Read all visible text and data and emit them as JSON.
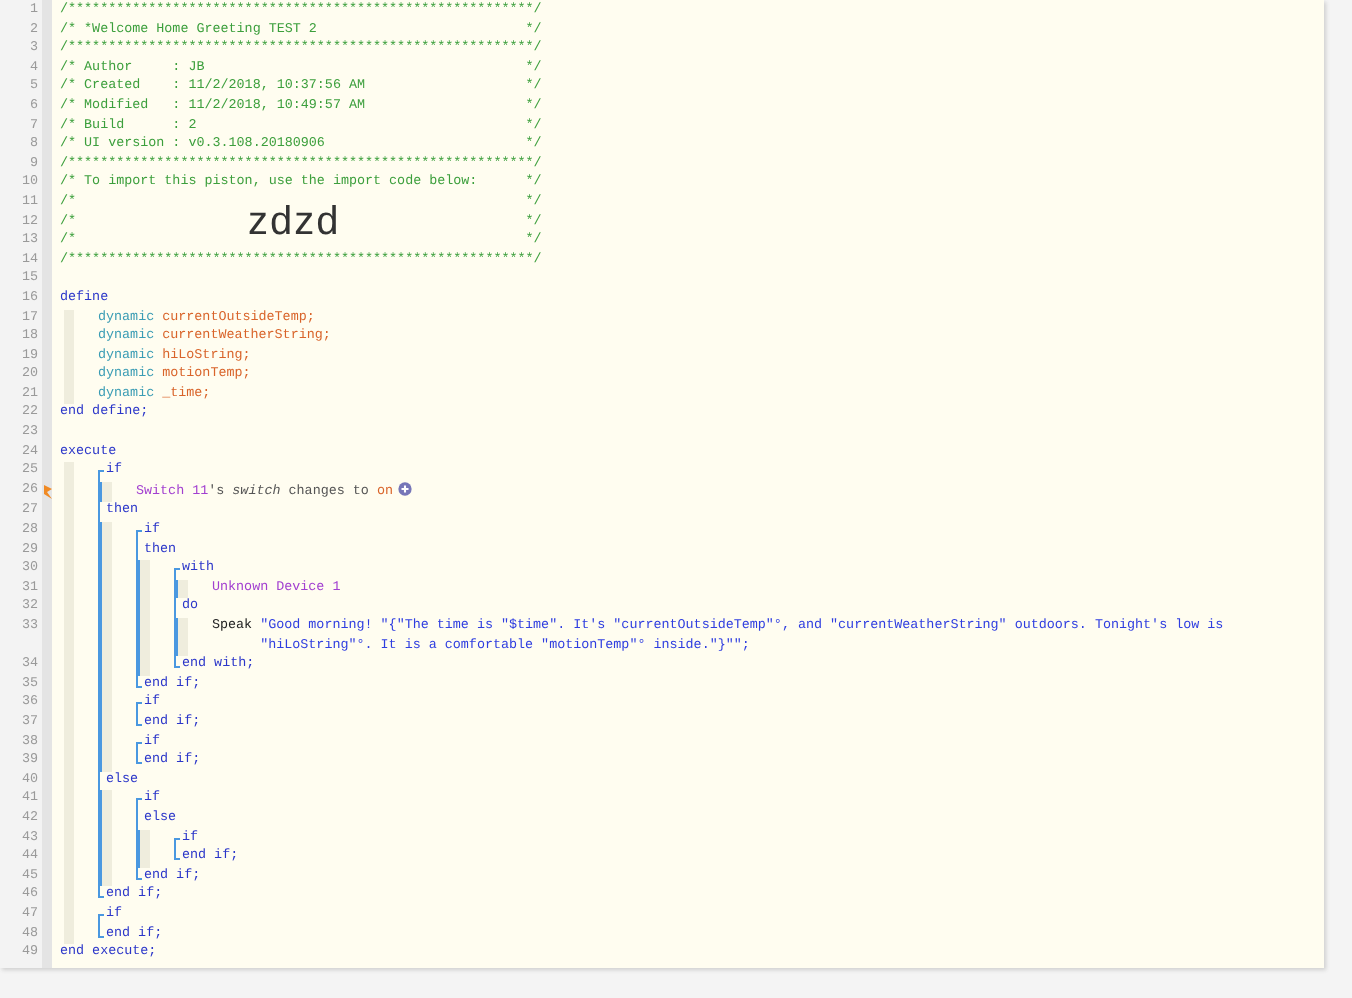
{
  "lines": [
    {
      "number": "1",
      "kind": "code",
      "flagged": false,
      "segments": [
        {
          "text": "/**********************************************************/",
          "kind": "comment"
        }
      ]
    },
    {
      "number": "2",
      "kind": "code",
      "flagged": false,
      "segments": [
        {
          "text": "/* *Welcome Home Greeting TEST 2",
          "kind": "comment"
        },
        {
          "text": "*/",
          "kind": "comment-end"
        }
      ]
    },
    {
      "number": "3",
      "kind": "code",
      "flagged": false,
      "segments": [
        {
          "text": "/**********************************************************/",
          "kind": "comment"
        }
      ]
    },
    {
      "number": "4",
      "kind": "code",
      "flagged": false,
      "segments": [
        {
          "text": "/* Author     : JB",
          "kind": "comment"
        },
        {
          "text": "*/",
          "kind": "comment-end"
        }
      ]
    },
    {
      "number": "5",
      "kind": "code",
      "flagged": false,
      "segments": [
        {
          "text": "/* Created    : 11/2/2018, 10:37:56 AM",
          "kind": "comment"
        },
        {
          "text": "*/",
          "kind": "comment-end"
        }
      ]
    },
    {
      "number": "6",
      "kind": "code",
      "flagged": false,
      "segments": [
        {
          "text": "/* Modified   : 11/2/2018, 10:49:57 AM",
          "kind": "comment"
        },
        {
          "text": "*/",
          "kind": "comment-end"
        }
      ]
    },
    {
      "number": "7",
      "kind": "code",
      "flagged": false,
      "segments": [
        {
          "text": "/* Build      : 2",
          "kind": "comment"
        },
        {
          "text": "*/",
          "kind": "comment-end"
        }
      ]
    },
    {
      "number": "8",
      "kind": "code",
      "flagged": false,
      "segments": [
        {
          "text": "/* UI version : v0.3.108.20180906",
          "kind": "comment"
        },
        {
          "text": "*/",
          "kind": "comment-end"
        }
      ]
    },
    {
      "number": "9",
      "kind": "code",
      "flagged": false,
      "segments": [
        {
          "text": "/**********************************************************/",
          "kind": "comment"
        }
      ]
    },
    {
      "number": "10",
      "kind": "code",
      "flagged": false,
      "segments": [
        {
          "text": "/* To import this piston, use the import code below:",
          "kind": "comment"
        },
        {
          "text": "*/",
          "kind": "comment-end"
        }
      ]
    },
    {
      "number": "11",
      "kind": "code",
      "flagged": false,
      "segments": [
        {
          "text": "/*",
          "kind": "comment"
        },
        {
          "text": "*/",
          "kind": "comment-end"
        }
      ]
    },
    {
      "number": "12",
      "kind": "code",
      "flagged": false,
      "segments": [
        {
          "text": "/*",
          "kind": "comment"
        },
        {
          "text": "zdzd",
          "kind": "big"
        },
        {
          "text": "*/",
          "kind": "comment-end"
        }
      ]
    },
    {
      "number": "13",
      "kind": "code",
      "flagged": false,
      "segments": [
        {
          "text": "/*",
          "kind": "comment"
        },
        {
          "text": "*/",
          "kind": "comment-end"
        }
      ]
    },
    {
      "number": "14",
      "kind": "code",
      "flagged": false,
      "segments": [
        {
          "text": "/**********************************************************/",
          "kind": "comment"
        }
      ]
    },
    {
      "number": "15",
      "kind": "code",
      "flagged": false
    },
    {
      "number": "16",
      "kind": "code",
      "flagged": false,
      "segments": [
        {
          "text": "define",
          "kind": "keyword"
        }
      ],
      "children": [
        {
          "number": "17",
          "kind": "code",
          "flagged": false,
          "segments": [
            {
              "text": "dynamic ",
              "kind": "type"
            },
            {
              "text": "currentOutsideTemp;",
              "kind": "variable"
            }
          ]
        },
        {
          "number": "18",
          "kind": "code",
          "flagged": false,
          "segments": [
            {
              "text": "dynamic ",
              "kind": "type"
            },
            {
              "text": "currentWeatherString;",
              "kind": "variable"
            }
          ]
        },
        {
          "number": "19",
          "kind": "code",
          "flagged": false,
          "segments": [
            {
              "text": "dynamic ",
              "kind": "type"
            },
            {
              "text": "hiLoString;",
              "kind": "variable"
            }
          ]
        },
        {
          "number": "20",
          "kind": "code",
          "flagged": false,
          "segments": [
            {
              "text": "dynamic ",
              "kind": "type"
            },
            {
              "text": "motionTemp;",
              "kind": "variable"
            }
          ]
        },
        {
          "number": "21",
          "kind": "code",
          "flagged": false,
          "segments": [
            {
              "text": "dynamic ",
              "kind": "type"
            },
            {
              "text": "_time;",
              "kind": "variable"
            }
          ]
        }
      ]
    },
    {
      "number": "22",
      "kind": "code",
      "flagged": false,
      "segments": [
        {
          "text": "end define;",
          "kind": "keyword"
        }
      ]
    },
    {
      "number": "23",
      "kind": "code",
      "flagged": false
    },
    {
      "number": "24",
      "kind": "code",
      "flagged": false,
      "segments": [
        {
          "text": "execute",
          "kind": "keyword"
        }
      ],
      "children": [
        {
          "number": "25",
          "kind": "open",
          "flagged": false,
          "segments": [
            {
              "text": "if",
              "kind": "keyword"
            }
          ],
          "children": [
            {
              "number": "26",
              "kind": "code",
              "flagged": true,
              "segments": [
                {
                  "text": "Switch 11",
                  "kind": "device"
                },
                {
                  "text": "'s *switch* changes to ",
                  "kind": "phrase"
                },
                {
                  "text": "on",
                  "kind": "value"
                },
                {
                  "kind": "add-icon"
                }
              ]
            }
          ]
        },
        {
          "number": "27",
          "kind": "code",
          "flagged": false,
          "segments": [
            {
              "text": "then",
              "kind": "keyword"
            }
          ],
          "children": [
            {
              "number": "28",
              "kind": "open",
              "flagged": false,
              "segments": [
                {
                  "text": "if",
                  "kind": "keyword"
                }
              ]
            },
            {
              "number": "29",
              "kind": "code",
              "flagged": false,
              "segments": [
                {
                  "text": "then",
                  "kind": "keyword"
                }
              ],
              "children": [
                {
                  "number": "30",
                  "kind": "open",
                  "flagged": false,
                  "segments": [
                    {
                      "text": "with",
                      "kind": "keyword"
                    }
                  ],
                  "children": [
                    {
                      "number": "31",
                      "kind": "code",
                      "flagged": false,
                      "segments": [
                        {
                          "text": "Unknown Device 1",
                          "kind": "device"
                        }
                      ]
                    }
                  ]
                },
                {
                  "number": "32",
                  "kind": "code",
                  "flagged": false,
                  "segments": [
                    {
                      "text": "do",
                      "kind": "keyword"
                    }
                  ],
                  "children": [
                    {
                      "number": "33",
                      "kind": "code",
                      "flagged": false,
                      "segments": [
                        {
                          "text": "Speak ",
                          "kind": "command"
                        },
                        {
                          "text": "\"Good morning! \"{\"The time is \"$time\". It's \"currentOutsideTemp\"°, and \"currentWeatherString\" outdoors. Tonight's low is \"hiLoString\"°. It is a comfortable \"motionTemp\"° inside.\"}\"\";",
                          "kind": "string"
                        }
                      ]
                    }
                  ]
                },
                {
                  "number": "34",
                  "kind": "close",
                  "flagged": false,
                  "segments": [
                    {
                      "text": "end with;",
                      "kind": "keyword"
                    }
                  ]
                }
              ]
            },
            {
              "number": "35",
              "kind": "close",
              "flagged": false,
              "segments": [
                {
                  "text": "end if;",
                  "kind": "keyword"
                }
              ]
            },
            {
              "number": "36",
              "kind": "open",
              "flagged": false,
              "segments": [
                {
                  "text": "if",
                  "kind": "keyword"
                }
              ]
            },
            {
              "number": "37",
              "kind": "close",
              "flagged": false,
              "segments": [
                {
                  "text": "end if;",
                  "kind": "keyword"
                }
              ]
            },
            {
              "number": "38",
              "kind": "open",
              "flagged": false,
              "segments": [
                {
                  "text": "if",
                  "kind": "keyword"
                }
              ]
            },
            {
              "number": "39",
              "kind": "close",
              "flagged": false,
              "segments": [
                {
                  "text": "end if;",
                  "kind": "keyword"
                }
              ]
            }
          ]
        },
        {
          "number": "40",
          "kind": "code",
          "flagged": false,
          "segments": [
            {
              "text": "else",
              "kind": "keyword"
            }
          ],
          "children": [
            {
              "number": "41",
              "kind": "open",
              "flagged": false,
              "segments": [
                {
                  "text": "if",
                  "kind": "keyword"
                }
              ]
            },
            {
              "number": "42",
              "kind": "code",
              "flagged": false,
              "segments": [
                {
                  "text": "else",
                  "kind": "keyword"
                }
              ],
              "children": [
                {
                  "number": "43",
                  "kind": "open",
                  "flagged": false,
                  "segments": [
                    {
                      "text": "if",
                      "kind": "keyword"
                    }
                  ]
                },
                {
                  "number": "44",
                  "kind": "close",
                  "flagged": false,
                  "segments": [
                    {
                      "text": "end if;",
                      "kind": "keyword"
                    }
                  ]
                }
              ]
            },
            {
              "number": "45",
              "kind": "close",
              "flagged": false,
              "segments": [
                {
                  "text": "end if;",
                  "kind": "keyword"
                }
              ]
            }
          ]
        },
        {
          "number": "46",
          "kind": "close",
          "flagged": false,
          "segments": [
            {
              "text": "end if;",
              "kind": "keyword"
            }
          ]
        },
        {
          "number": "47",
          "kind": "open",
          "flagged": false,
          "segments": [
            {
              "text": "if",
              "kind": "keyword"
            }
          ]
        },
        {
          "number": "48",
          "kind": "close",
          "flagged": false,
          "segments": [
            {
              "text": "end if;",
              "kind": "keyword"
            }
          ]
        }
      ]
    },
    {
      "number": "49",
      "kind": "code",
      "flagged": false,
      "segments": [
        {
          "text": "end execute;",
          "kind": "keyword"
        }
      ]
    }
  ]
}
